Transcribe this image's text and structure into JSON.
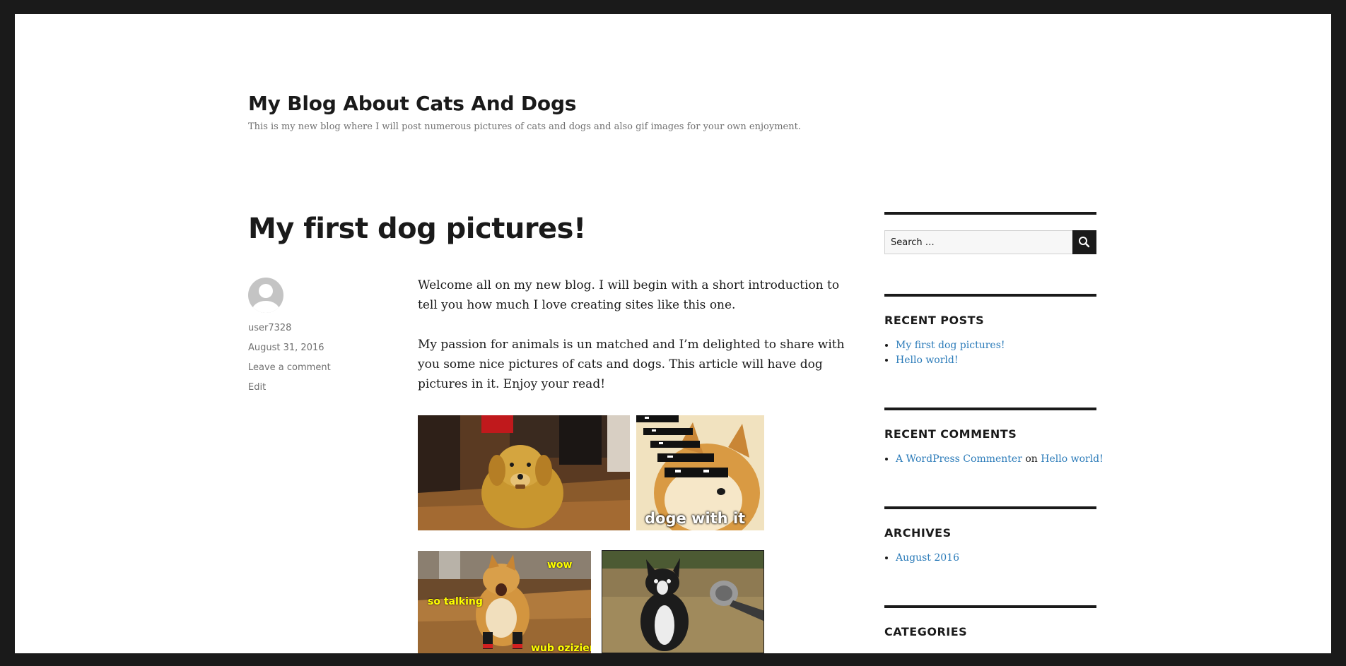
{
  "site": {
    "title": "My Blog About Cats And Dogs",
    "tagline": "This is my new blog where I will post numerous pictures of cats and dogs and also gif images for your own enjoyment."
  },
  "post": {
    "title": "My first dog pictures!",
    "author": "user7328",
    "date": "August 31, 2016",
    "comment_link": "Leave a comment",
    "edit_link": "Edit",
    "paragraphs": [
      "Welcome all on my new blog. I will begin with a short introduction to tell you how much I love creating sites like this one.",
      "My passion for animals is un matched and I’m delighted to share with you some nice pictures of cats and dogs. This article will have dog pictures in it. Enjoy your read!"
    ],
    "images": [
      {
        "name": "golden-retriever-gif",
        "caption": ""
      },
      {
        "name": "doge-sunglasses-gif",
        "caption": "doge with it"
      },
      {
        "name": "shiba-boots-gif",
        "captions": [
          "wow",
          "so talking",
          "wub ozizien"
        ]
      },
      {
        "name": "boston-terrier-gif",
        "caption": ""
      }
    ]
  },
  "sidebar": {
    "search": {
      "placeholder": "Search …",
      "icon": "search-icon"
    },
    "recent_posts": {
      "title": "RECENT POSTS",
      "items": [
        "My first dog pictures!",
        "Hello world!"
      ]
    },
    "recent_comments": {
      "title": "RECENT COMMENTS",
      "author": "A WordPress Commenter",
      "on": "on",
      "post": "Hello world!"
    },
    "archives": {
      "title": "ARCHIVES",
      "items": [
        "August 2016"
      ]
    },
    "categories": {
      "title": "CATEGORIES"
    }
  },
  "colors": {
    "outer_frame": "#1a1a1a",
    "page_background": "#ffffff",
    "text": "#1a1a1a",
    "meta_text": "#707070",
    "link": "#2b7bb9",
    "caption_yellow": "#ffff00"
  }
}
